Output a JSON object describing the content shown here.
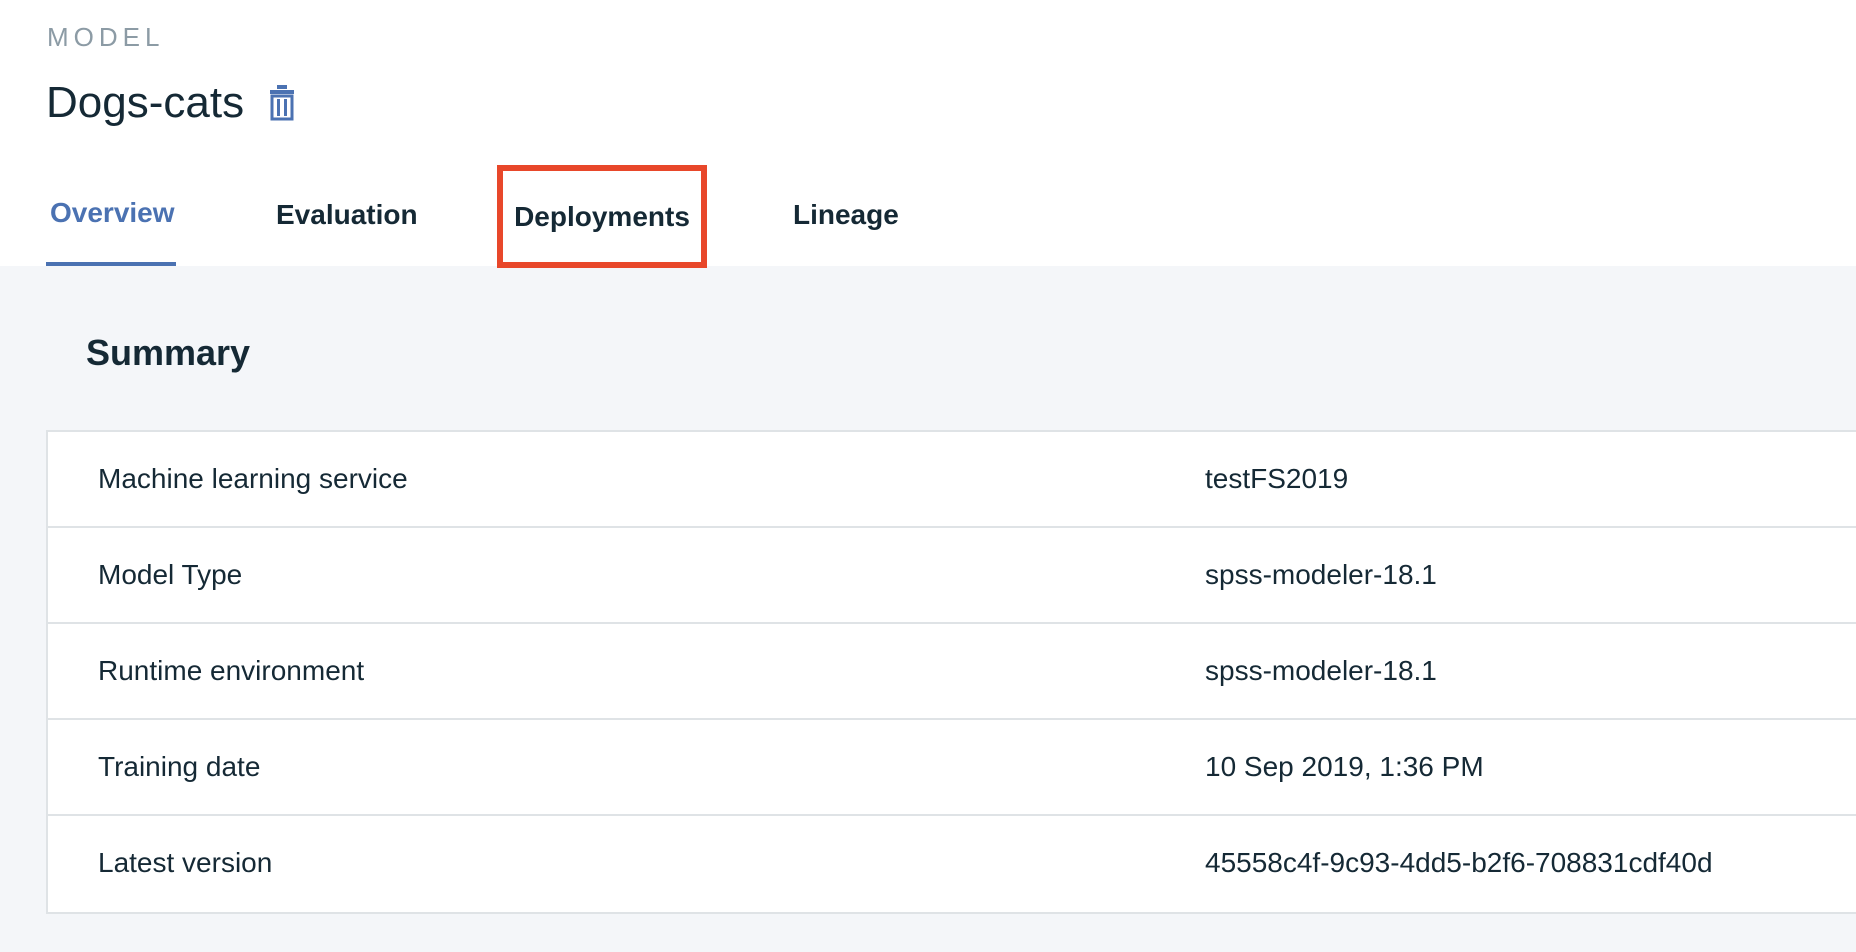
{
  "header": {
    "eyebrow": "MODEL",
    "title": "Dogs-cats",
    "delete_icon": "trash-icon"
  },
  "tabs": [
    {
      "label": "Overview",
      "active": true
    },
    {
      "label": "Evaluation",
      "active": false
    },
    {
      "label": "Deployments",
      "active": false,
      "highlighted": true
    },
    {
      "label": "Lineage",
      "active": false
    }
  ],
  "summary": {
    "heading": "Summary",
    "rows": [
      {
        "label": "Machine learning service",
        "value": "testFS2019"
      },
      {
        "label": "Model Type",
        "value": "spss-modeler-18.1"
      },
      {
        "label": "Runtime environment",
        "value": "spss-modeler-18.1"
      },
      {
        "label": "Training date",
        "value": "10 Sep 2019, 1:36 PM"
      },
      {
        "label": "Latest version",
        "value": "45558c4f-9c93-4dd5-b2f6-708831cdf40d"
      }
    ]
  },
  "colors": {
    "accent": "#4b72b2",
    "highlight_border": "#e8472a",
    "page_background": "#f4f6f9",
    "text": "#152935"
  }
}
